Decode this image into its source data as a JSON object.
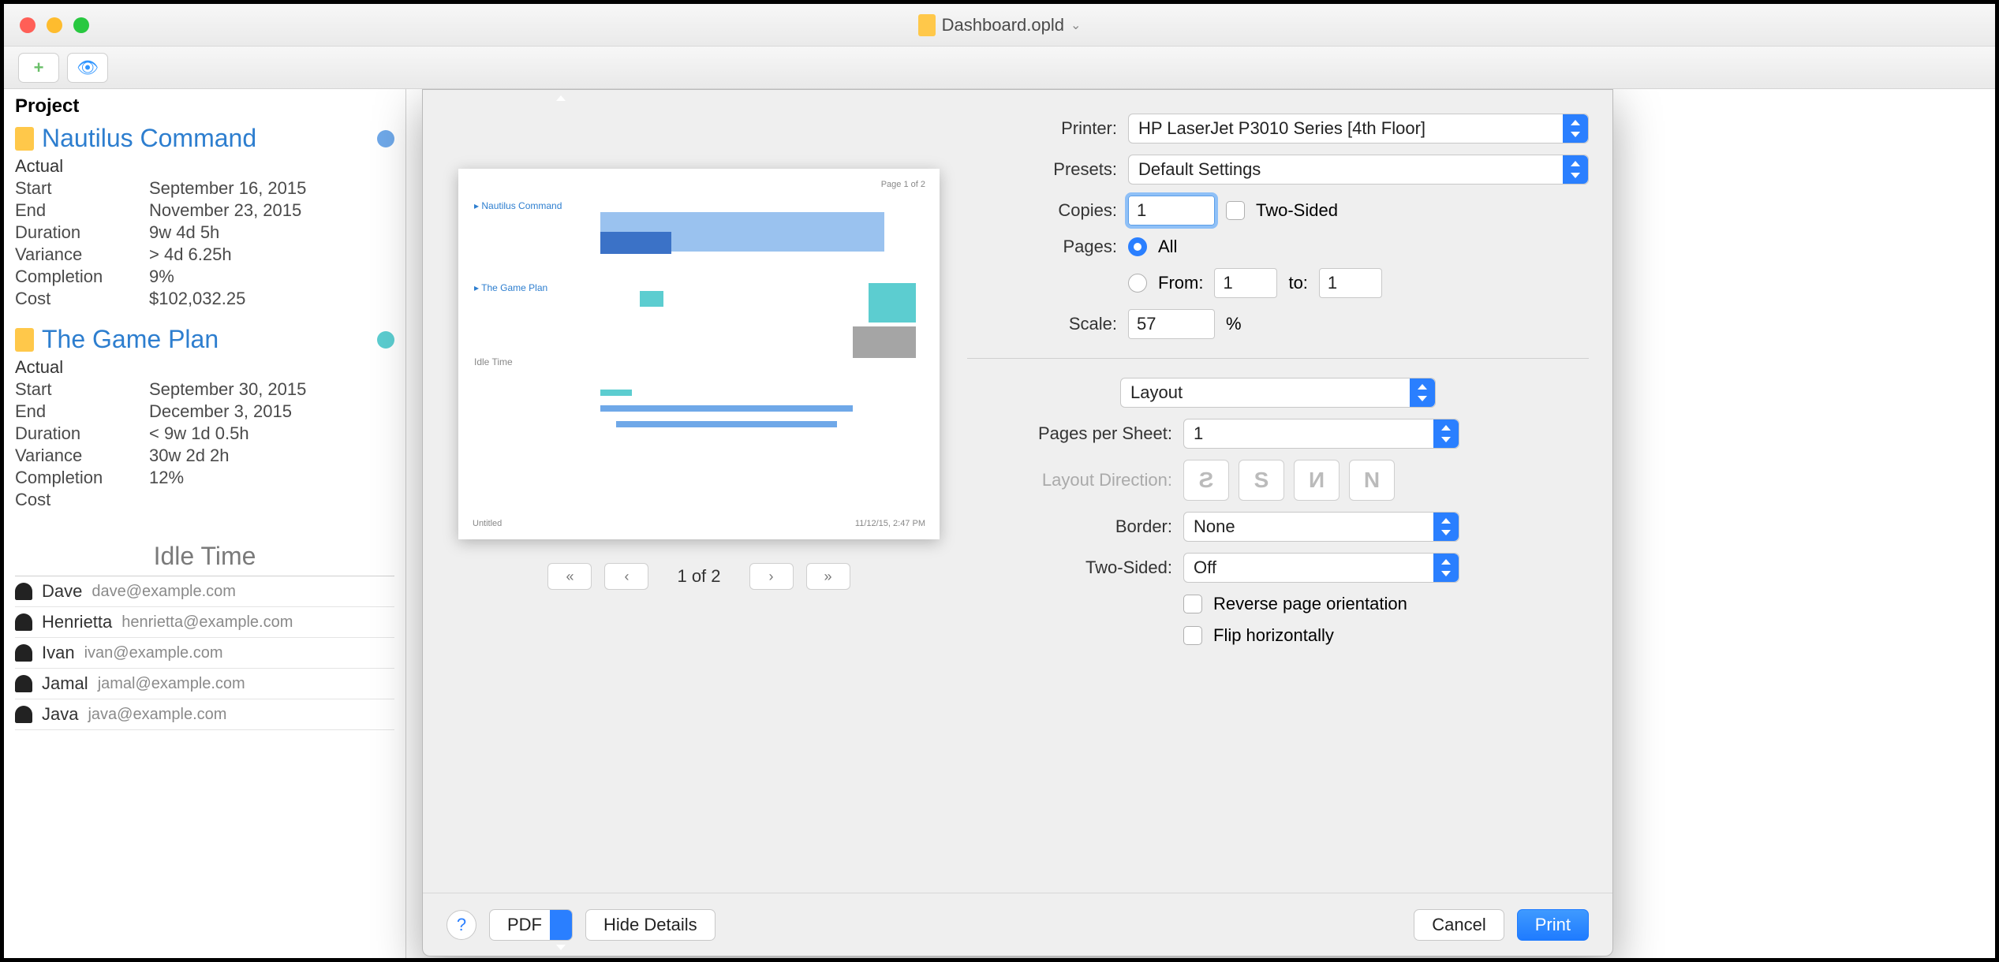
{
  "window": {
    "title": "Dashboard.opld"
  },
  "sidebar": {
    "header": "Project",
    "projects": [
      {
        "title": "Nautilus Command",
        "status_color": "#6fa8e8",
        "actual_label": "Actual",
        "fields": {
          "start_k": "Start",
          "start_v": "September 16, 2015",
          "end_k": "End",
          "end_v": "November 23, 2015",
          "duration_k": "Duration",
          "duration_v": "9w 4d 5h",
          "variance_k": "Variance",
          "variance_v": "> 4d 6.25h",
          "completion_k": "Completion",
          "completion_v": "9%",
          "cost_k": "Cost",
          "cost_v": "$102,032.25"
        }
      },
      {
        "title": "The Game Plan",
        "status_color": "#5ccdd0",
        "actual_label": "Actual",
        "fields": {
          "start_k": "Start",
          "start_v": "September 30, 2015",
          "end_k": "End",
          "end_v": "December 3, 2015",
          "duration_k": "Duration",
          "duration_v": "< 9w 1d 0.5h",
          "variance_k": "Variance",
          "variance_v": "30w 2d 2h",
          "completion_k": "Completion",
          "completion_v": "12%",
          "cost_k": "Cost",
          "cost_v": ""
        }
      }
    ],
    "idle_header": "Idle Time",
    "people": [
      {
        "name": "Dave",
        "email": "dave@example.com"
      },
      {
        "name": "Henrietta",
        "email": "henrietta@example.com"
      },
      {
        "name": "Ivan",
        "email": "ivan@example.com"
      },
      {
        "name": "Jamal",
        "email": "jamal@example.com"
      },
      {
        "name": "Java",
        "email": "java@example.com"
      }
    ]
  },
  "print": {
    "printer_label": "Printer:",
    "printer_value": "HP LaserJet P3010 Series [4th Floor]",
    "presets_label": "Presets:",
    "presets_value": "Default Settings",
    "copies_label": "Copies:",
    "copies_value": "1",
    "two_sided_chk": "Two-Sided",
    "pages_label": "Pages:",
    "pages_all": "All",
    "pages_from": "From:",
    "pages_from_v": "1",
    "pages_to": "to:",
    "pages_to_v": "1",
    "scale_label": "Scale:",
    "scale_value": "57",
    "scale_unit": "%",
    "section_select": "Layout",
    "pps_label": "Pages per Sheet:",
    "pps_value": "1",
    "layoutdir_label": "Layout Direction:",
    "border_label": "Border:",
    "border_value": "None",
    "twosided_label": "Two-Sided:",
    "twosided_value": "Off",
    "reverse_chk": "Reverse page orientation",
    "flip_chk": "Flip horizontally",
    "page_nav": "1 of 2",
    "help_icon": "?",
    "pdf_btn": "PDF",
    "hide_btn": "Hide Details",
    "cancel_btn": "Cancel",
    "print_btn": "Print"
  }
}
